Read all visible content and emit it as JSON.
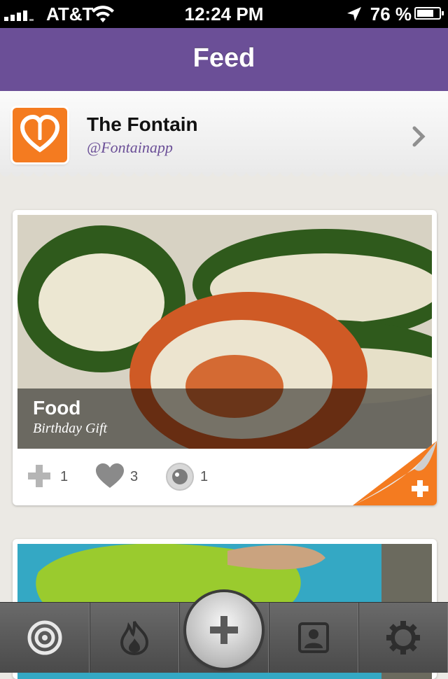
{
  "status_bar": {
    "carrier": "AT&T",
    "time": "12:24 PM",
    "battery_percent": "76 %",
    "battery_level": 0.76,
    "icons": [
      "signal-icon",
      "wifi-icon",
      "location-arrow-icon",
      "battery-icon"
    ]
  },
  "nav": {
    "title": "Feed"
  },
  "profile": {
    "name": "The Fontain",
    "handle": "@Fontainapp",
    "icon": "fontain-logo-icon",
    "accent": "#f47b20"
  },
  "posts": [
    {
      "title": "Food",
      "subtitle": "Birthday Gift",
      "actions": {
        "add_count": "1",
        "like_count": "3",
        "view_count": "1"
      }
    }
  ],
  "tab_bar": {
    "items": [
      "target-icon",
      "flame-icon",
      "add-icon",
      "profile-icon",
      "settings-gear-icon"
    ]
  },
  "colors": {
    "nav_purple": "#6b4f97",
    "accent_orange": "#f47b20",
    "tab_bar": "#555555"
  }
}
